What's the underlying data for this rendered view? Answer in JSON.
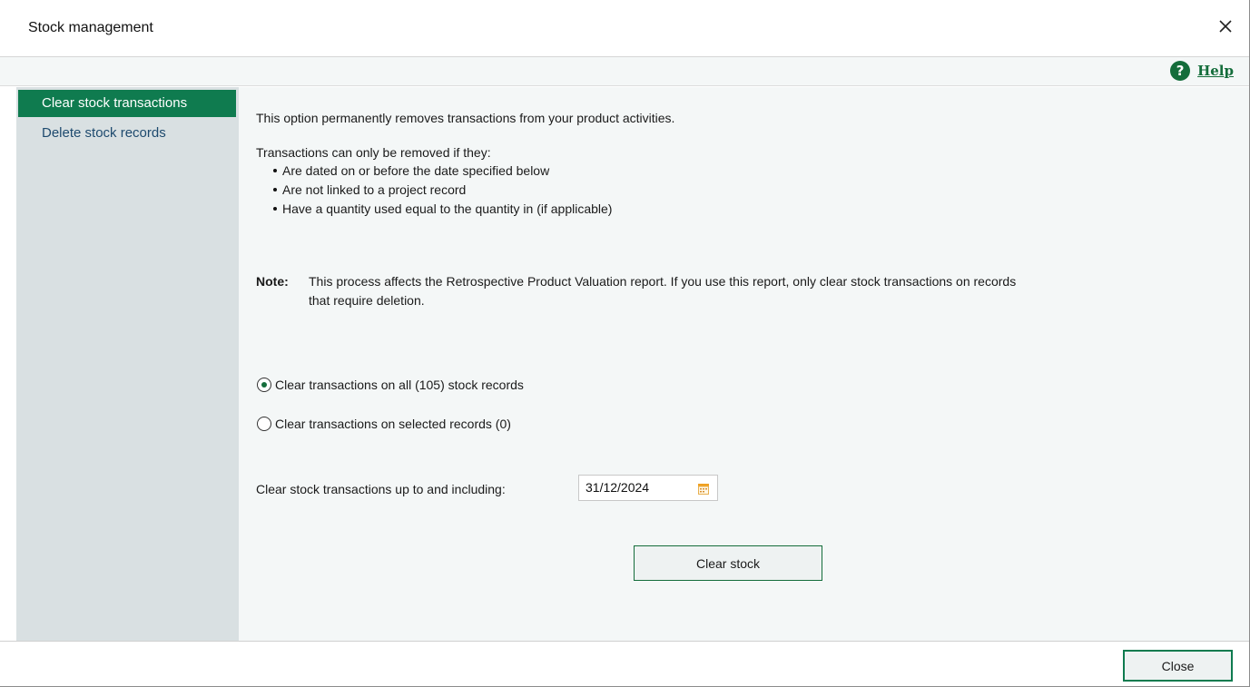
{
  "window": {
    "title": "Stock management"
  },
  "helpbar": {
    "help_label": "Help"
  },
  "sidebar": {
    "items": [
      {
        "label": "Clear stock transactions",
        "active": true
      },
      {
        "label": "Delete stock records",
        "active": false
      }
    ]
  },
  "content": {
    "intro": "This option permanently removes transactions from your product activities.",
    "conditions_heading": "Transactions can only be removed if they:",
    "conditions": [
      "Are dated on or before the date specified below",
      "Are not linked to a project record",
      "Have a quantity used equal to the quantity in (if applicable)"
    ],
    "note_label": "Note:",
    "note_line1": "This process affects the Retrospective Product Valuation report. If you use this report, only clear stock transactions on records",
    "note_line2": "that require deletion.",
    "radio_all": {
      "label": "Clear transactions on all (105) stock records",
      "checked": true
    },
    "radio_selected": {
      "label": "Clear transactions on selected records (0)",
      "checked": false
    },
    "date_label": "Clear stock transactions up to and including:",
    "date_value": "31/12/2024",
    "clear_button": "Clear stock"
  },
  "footer": {
    "close_button": "Close"
  },
  "colors": {
    "accent": "#0f7b4f",
    "help": "#146d3b",
    "sidebar_bg": "#d9e0e2",
    "content_bg": "#f4f7f7"
  }
}
